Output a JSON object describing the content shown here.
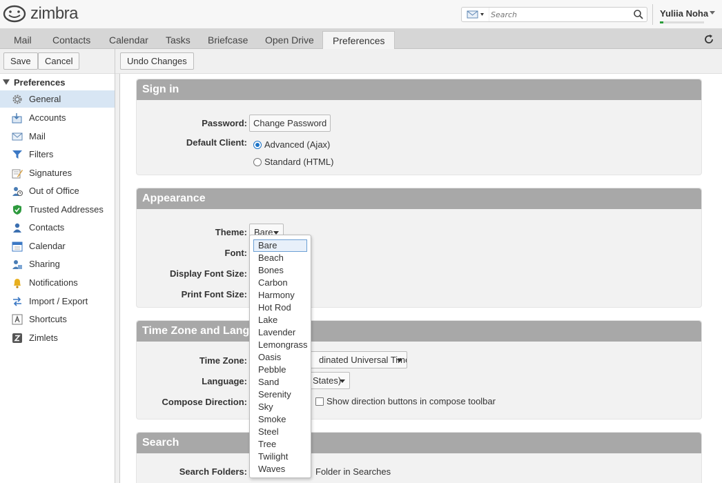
{
  "header": {
    "brand": "zimbra",
    "search_placeholder": "Search",
    "user_name": "Yuliia Noha",
    "quota_fraction": 0.08
  },
  "tabs": [
    {
      "label": "Mail"
    },
    {
      "label": "Contacts"
    },
    {
      "label": "Calendar"
    },
    {
      "label": "Tasks"
    },
    {
      "label": "Briefcase"
    },
    {
      "label": "Open Drive"
    },
    {
      "label": "Preferences",
      "active": true
    }
  ],
  "toolbar": {
    "save_label": "Save",
    "cancel_label": "Cancel",
    "undo_label": "Undo Changes"
  },
  "sidebar": {
    "header": "Preferences",
    "items": [
      {
        "label": "General",
        "icon": "gear-icon",
        "selected": true
      },
      {
        "label": "Accounts",
        "icon": "accounts-icon"
      },
      {
        "label": "Mail",
        "icon": "mail-icon"
      },
      {
        "label": "Filters",
        "icon": "filter-icon"
      },
      {
        "label": "Signatures",
        "icon": "signature-icon"
      },
      {
        "label": "Out of Office",
        "icon": "out-of-office-icon"
      },
      {
        "label": "Trusted Addresses",
        "icon": "shield-icon"
      },
      {
        "label": "Contacts",
        "icon": "contact-icon"
      },
      {
        "label": "Calendar",
        "icon": "calendar-icon"
      },
      {
        "label": "Sharing",
        "icon": "sharing-icon"
      },
      {
        "label": "Notifications",
        "icon": "bell-icon"
      },
      {
        "label": "Import / Export",
        "icon": "import-export-icon"
      },
      {
        "label": "Shortcuts",
        "icon": "shortcut-icon"
      },
      {
        "label": "Zimlets",
        "icon": "zimlet-icon"
      }
    ]
  },
  "signin": {
    "title": "Sign in",
    "password_label": "Password:",
    "change_password_label": "Change Password",
    "default_client_label": "Default Client:",
    "client_options": [
      "Advanced (Ajax)",
      "Standard (HTML)"
    ],
    "client_selected": "Advanced (Ajax)"
  },
  "appearance": {
    "title": "Appearance",
    "theme_label": "Theme:",
    "theme_value": "Bare",
    "font_label": "Font:",
    "display_font_size_label": "Display Font Size:",
    "print_font_size_label": "Print Font Size:"
  },
  "timezone": {
    "title": "Time Zone and Lang",
    "timezone_label": "Time Zone:",
    "timezone_value": "dinated Universal Time",
    "language_label": "Language:",
    "language_value": "States)",
    "compose_direction_label": "Compose Direction:",
    "compose_direction_checkbox": "Show direction buttons in compose toolbar"
  },
  "search": {
    "title": "Search",
    "folders_label": "Search Folders:",
    "folders_text": "Folder in Searches"
  },
  "theme_dropdown": {
    "options": [
      "Bare",
      "Beach",
      "Bones",
      "Carbon",
      "Harmony",
      "Hot Rod",
      "Lake",
      "Lavender",
      "Lemongrass",
      "Oasis",
      "Pebble",
      "Sand",
      "Serenity",
      "Sky",
      "Smoke",
      "Steel",
      "Tree",
      "Twilight",
      "Waves"
    ],
    "highlighted": "Bare"
  }
}
